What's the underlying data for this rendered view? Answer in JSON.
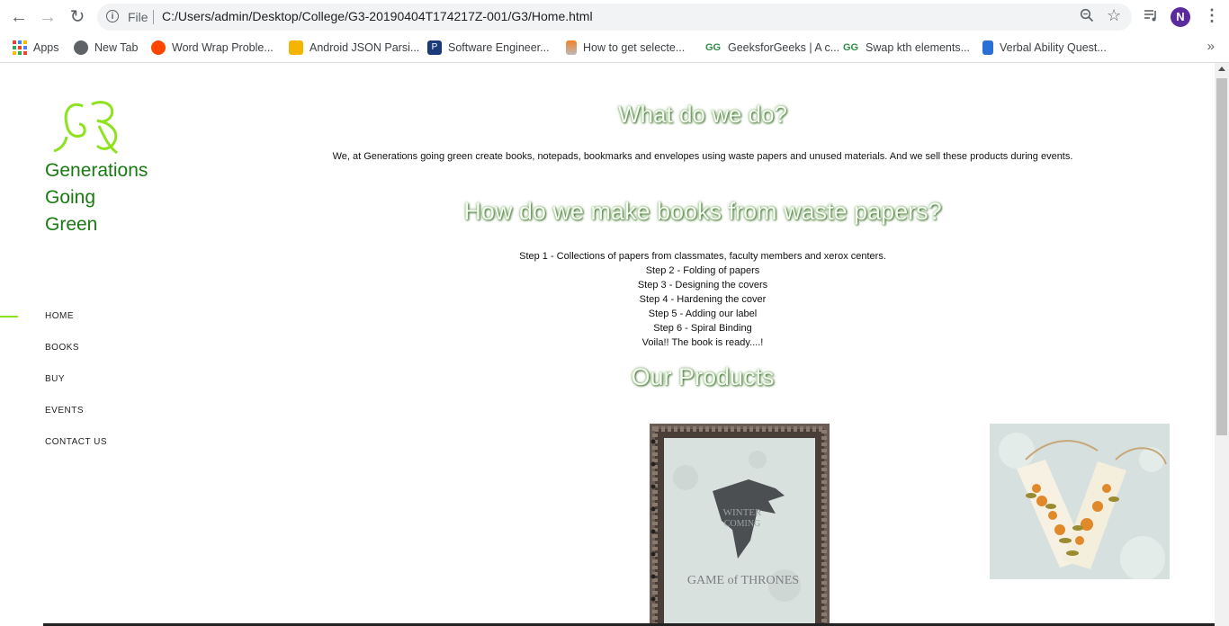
{
  "browser": {
    "file_label": "File",
    "url": "C:/Users/admin/Desktop/College/G3-20190404T174217Z-001/G3/Home.html",
    "profile_initial": "N"
  },
  "bookmarks": {
    "apps_label": "Apps",
    "items": [
      {
        "label": "New Tab",
        "icon": "globe-icon"
      },
      {
        "label": "Word Wrap Proble...",
        "icon": "reddit-icon"
      },
      {
        "label": "Android JSON Parsi...",
        "icon": "android-json-icon"
      },
      {
        "label": "Software Engineer...",
        "icon": "p-icon"
      },
      {
        "label": "How to get selecte...",
        "icon": "stackoverflow-icon"
      },
      {
        "label": "GeeksforGeeks | A c...",
        "icon": "gfg-icon"
      },
      {
        "label": "Swap kth elements...",
        "icon": "gfg-icon"
      },
      {
        "label": "Verbal Ability Quest...",
        "icon": "indiabix-icon"
      }
    ]
  },
  "site": {
    "logo_text": "G3",
    "brand_lines": [
      "Generations",
      "Going",
      "Green"
    ],
    "nav": [
      "HOME",
      "BOOKS",
      "BUY",
      "EVENTS",
      "CONTACT US"
    ],
    "accent_color": "#8ee21e",
    "brand_color": "#1a7a12"
  },
  "main": {
    "heading1": "What do we do?",
    "intro": "We, at Generations going green create books, notepads, bookmarks and envelopes using waste papers and unused materials. And we sell these products during events.",
    "heading2": "How do we make books from waste papers?",
    "steps": [
      "Step 1 - Collections of papers from classmates, faculty members and xerox centers.",
      "Step 2 - Folding of papers",
      "Step 3 - Designing the covers",
      "Step 4 - Hardening the cover",
      "Step 5 - Adding our label",
      "Step 6 - Spiral Binding",
      "Voila!! The book is ready....!"
    ],
    "heading3": "Our Products",
    "product1_cover_text": [
      "WINTER",
      "COMING",
      "GAME of THRONES"
    ]
  }
}
